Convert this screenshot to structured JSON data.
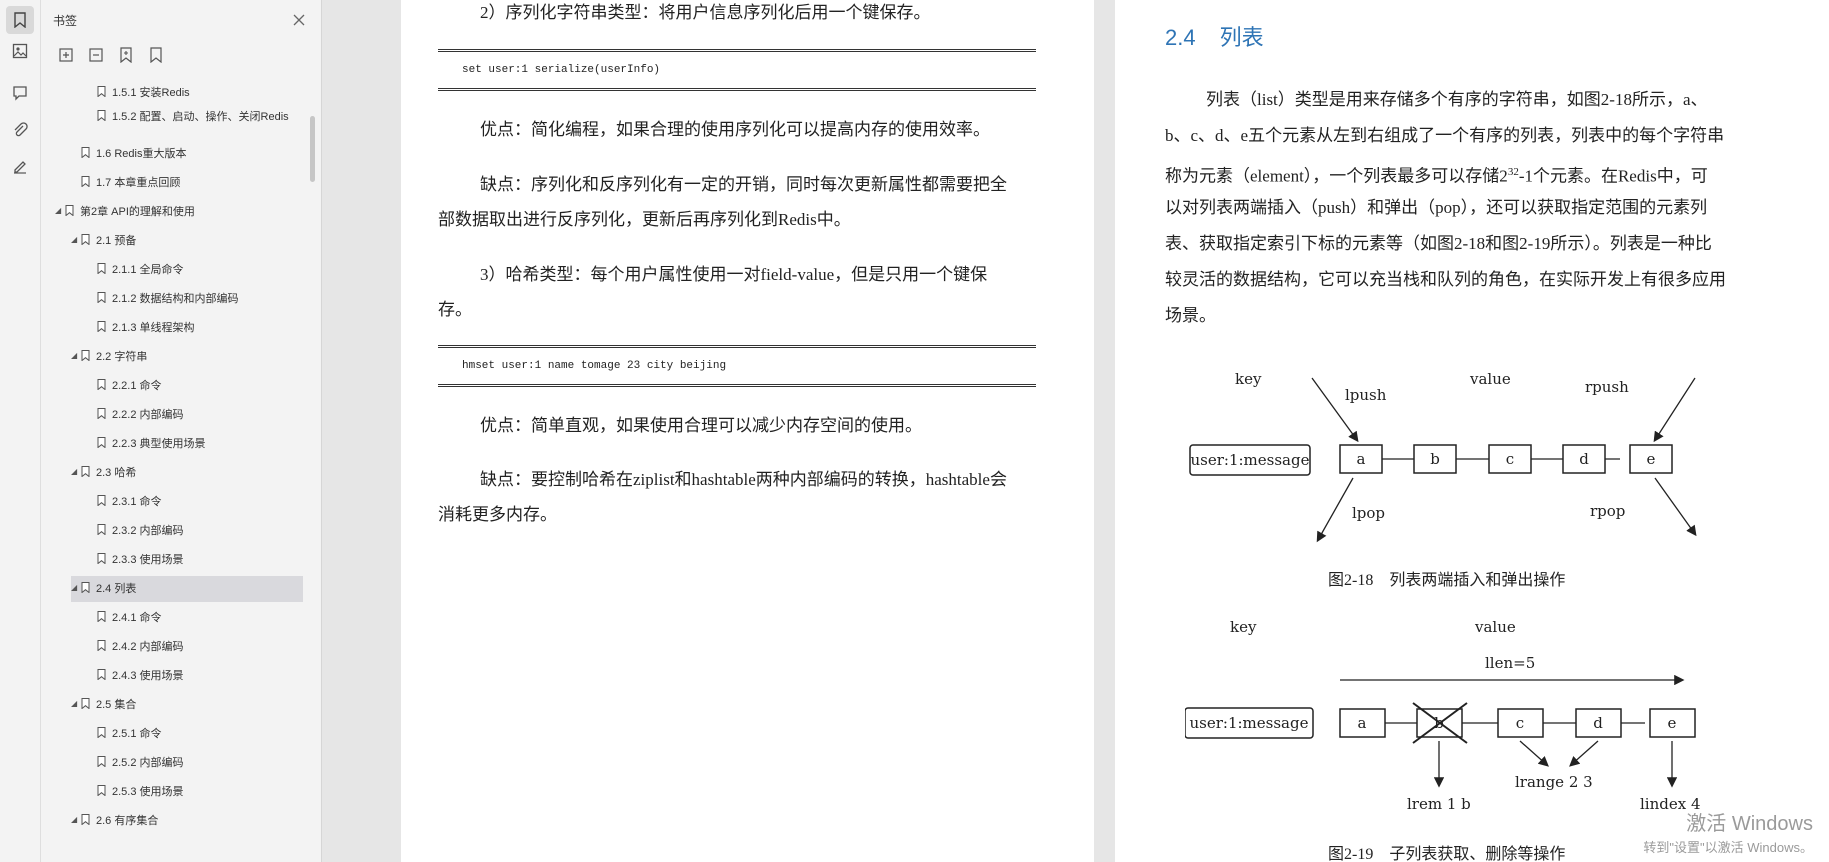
{
  "sidebar": {
    "title": "书签",
    "tools": [
      "expand-all-icon",
      "collapse-all-icon",
      "add-bookmark-icon",
      "bookmark-icon"
    ],
    "items": [
      {
        "label": "1.5.1 安装Redis",
        "level": 3,
        "expanded": null
      },
      {
        "label": "1.5.2 配置、启动、操作、关闭Redis",
        "level": 3,
        "expanded": null
      },
      {
        "label": "1.6 Redis重大版本",
        "level": 2,
        "expanded": null
      },
      {
        "label": "1.7 本章重点回顾",
        "level": 2,
        "expanded": null
      },
      {
        "label": "第2章 API的理解和使用",
        "level": 1,
        "expanded": true
      },
      {
        "label": "2.1 预备",
        "level": 2,
        "expanded": true
      },
      {
        "label": "2.1.1 全局命令",
        "level": 3,
        "expanded": null
      },
      {
        "label": "2.1.2 数据结构和内部编码",
        "level": 3,
        "expanded": null
      },
      {
        "label": "2.1.3 单线程架构",
        "level": 3,
        "expanded": null
      },
      {
        "label": "2.2 字符串",
        "level": 2,
        "expanded": true
      },
      {
        "label": "2.2.1 命令",
        "level": 3,
        "expanded": null
      },
      {
        "label": "2.2.2 内部编码",
        "level": 3,
        "expanded": null
      },
      {
        "label": "2.2.3 典型使用场景",
        "level": 3,
        "expanded": null
      },
      {
        "label": "2.3 哈希",
        "level": 2,
        "expanded": true
      },
      {
        "label": "2.3.1 命令",
        "level": 3,
        "expanded": null
      },
      {
        "label": "2.3.2 内部编码",
        "level": 3,
        "expanded": null
      },
      {
        "label": "2.3.3 使用场景",
        "level": 3,
        "expanded": null
      },
      {
        "label": "2.4 列表",
        "level": 2,
        "expanded": true,
        "selected": true
      },
      {
        "label": "2.4.1 命令",
        "level": 3,
        "expanded": null
      },
      {
        "label": "2.4.2 内部编码",
        "level": 3,
        "expanded": null
      },
      {
        "label": "2.4.3 使用场景",
        "level": 3,
        "expanded": null
      },
      {
        "label": "2.5 集合",
        "level": 2,
        "expanded": true
      },
      {
        "label": "2.5.1 命令",
        "level": 3,
        "expanded": null
      },
      {
        "label": "2.5.2 内部编码",
        "level": 3,
        "expanded": null
      },
      {
        "label": "2.5.3 使用场景",
        "level": 3,
        "expanded": null
      },
      {
        "label": "2.6 有序集合",
        "level": 2,
        "expanded": true
      }
    ]
  },
  "rail_icons": [
    "bookmark-icon",
    "thumbnail-icon",
    "comment-icon",
    "attachment-icon",
    "signature-icon"
  ],
  "left_page": {
    "p1": "2）序列化字符串类型：将用户信息序列化后用一个键保存。",
    "code1": "set user:1 serialize(userInfo)",
    "p2": "优点：简化编程，如果合理的使用序列化可以提高内存的使用效率。",
    "p3_line1": "缺点：序列化和反序列化有一定的开销，同时每次更新属性都需要把全",
    "p3_line2": "部数据取出进行反序列化，更新后再序列化到Redis中。",
    "p4_line1": "3）哈希类型：每个用户属性使用一对field-value，但是只用一个键保",
    "p4_line2": "存。",
    "code2": "hmset user:1 name tomage 23 city beijing",
    "p5": "优点：简单直观，如果使用合理可以减少内存空间的使用。",
    "p6_line1": "缺点：要控制哈希在ziplist和hashtable两种内部编码的转换，hashtable会",
    "p6_line2": "消耗更多内存。"
  },
  "right_page": {
    "section_num": "2.4",
    "section_title": "列表",
    "para": [
      "列表（list）类型是用来存储多个有序的字符串，如图2-18所示，a、",
      "b、c、d、e五个元素从左到右组成了一个有序的列表，列表中的每个字符串",
      "称为元素（element），一个列表最多可以存储2",
      "以对列表两端插入（push）和弹出（pop），还可以获取指定范围的元素列",
      "表、获取指定索引下标的元素等（如图2-18和图2-19所示）。列表是一种比",
      "较灵活的数据结构，它可以充当栈和队列的角色，在实际开发上有很多应用",
      "场景。"
    ],
    "para_sup": "32",
    "para_tail": "-1个元素。在Redis中，可",
    "fig1": {
      "key_label": "key",
      "value_label": "value",
      "key_text": "user:1:message",
      "elements": [
        "a",
        "b",
        "c",
        "d",
        "e"
      ],
      "lpush": "lpush",
      "rpush": "rpush",
      "lpop": "lpop",
      "rpop": "rpop",
      "caption": "图2-18　列表两端插入和弹出操作"
    },
    "fig2": {
      "key_label": "key",
      "value_label": "value",
      "llen": "llen=5",
      "key_text": "user:1:message",
      "elements": [
        "a",
        "b",
        "c",
        "d",
        "e"
      ],
      "lrem": "lrem 1 b",
      "lrange": "lrange 2 3",
      "lindex": "lindex 4",
      "caption": "图2-19　子列表获取、删除等操作"
    }
  },
  "watermark": {
    "line1": "激活 Windows",
    "line2": "转到\"设置\"以激活 Windows。"
  }
}
